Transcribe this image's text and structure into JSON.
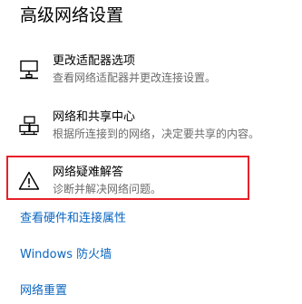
{
  "section_title": "高级网络设置",
  "options": [
    {
      "name": "更改适配器选项",
      "description": "查看网络适配器并更改连接设置。",
      "icon": "network-adapter-icon"
    },
    {
      "name": "网络和共享中心",
      "description": "根据所连接到的网络，决定要共享的内容。",
      "icon": "network-sharing-icon"
    },
    {
      "name": "网络疑难解答",
      "description": "诊断并解决网络问题。",
      "icon": "warning-icon"
    }
  ],
  "links": [
    {
      "label": "查看硬件和连接属性"
    },
    {
      "label": "Windows 防火墙"
    },
    {
      "label": "网络重置"
    }
  ],
  "colors": {
    "link": "#0a66c2",
    "highlight_border": "#e8202a",
    "description_text": "#6b6b6b"
  }
}
